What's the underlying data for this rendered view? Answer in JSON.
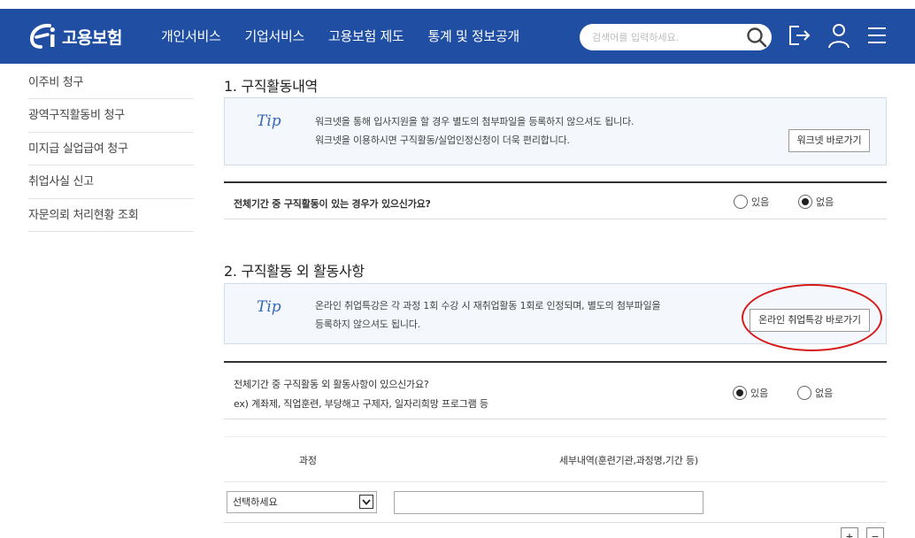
{
  "header": {
    "logo_text": "고용보험",
    "nav": [
      "개인서비스",
      "기업서비스",
      "고용보험 제도",
      "통계 및 정보공개"
    ],
    "search_placeholder": "검색어를 입력하세요.",
    "icons": [
      "search-icon",
      "logout-icon",
      "user-icon",
      "menu-icon"
    ],
    "bg_color": "#1f4ea3"
  },
  "sidebar": {
    "items": [
      "이주비 청구",
      "광역구직활동비 청구",
      "미지급 실업급여 청구",
      "취업사실 신고",
      "자문의뢰 처리현황 조회"
    ]
  },
  "section1": {
    "title": "1. 구직활동내역",
    "tip_label": "Tip",
    "tip_lines": [
      "워크넷을 통해 입사지원을 할 경우 별도의 첨부파일을 등록하지 않으셔도 됩니다.",
      "워크넷을 이용하시면 구직활동/실업인정신청이 더욱 편리합니다."
    ],
    "button": "워크넷 바로가기",
    "question": "전체기간 중 구직활동이 있는 경우가 있으신가요?",
    "options": [
      "있음",
      "없음"
    ],
    "selected": "없음"
  },
  "section2": {
    "title": "2. 구직활동 외 활동사항",
    "tip_label": "Tip",
    "tip_lines": [
      "온라인 취업특강은 각 과정 1회 수강 시 재취업활동 1회로 인정되며, 별도의 첨부파일을",
      "등록하지 않으셔도 됩니다."
    ],
    "button": "온라인 취업특강 바로가기",
    "question": "전체기간 중 구직활동 외 활동사항이 있으신가요?",
    "question_sub": "ex) 계좌제, 직업훈련, 부당해고 구제자, 일자리희망 프로그램 등",
    "options": [
      "있음",
      "없음"
    ],
    "selected": "있음",
    "table": {
      "col_course": "과정",
      "col_detail": "세부내역(훈련기관,과정명,기간 등)",
      "select_value": "선택하세요",
      "plus": "+",
      "minus": "−"
    }
  }
}
